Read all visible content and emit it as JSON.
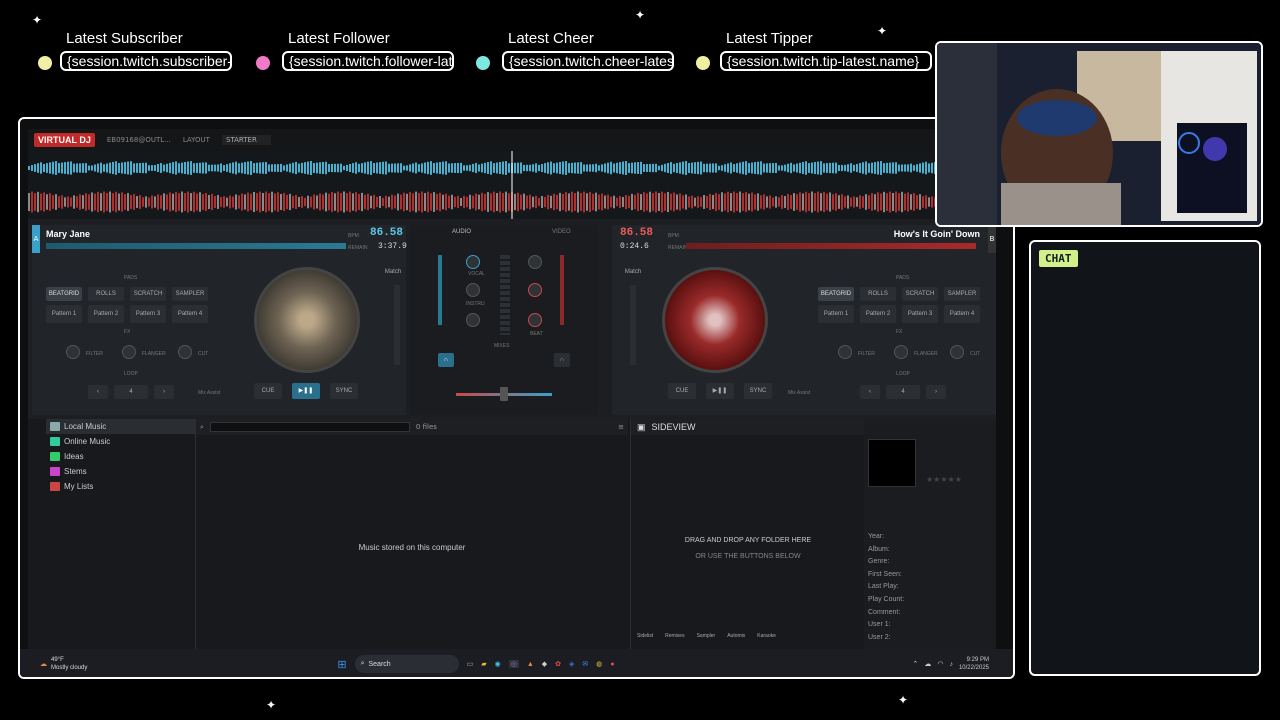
{
  "overlay": {
    "alerts": [
      {
        "title": "Latest Subscriber",
        "value": "{session.twitch.subscriber-latest.name}",
        "icon": "star-icon",
        "color": "#f2f0a8"
      },
      {
        "title": "Latest Follower",
        "value": "{session.twitch.follower-latest.name}",
        "icon": "heart-icon",
        "color": "#f07ac8"
      },
      {
        "title": "Latest Cheer",
        "value": "{session.twitch.cheer-latest.name}",
        "icon": "gem-icon",
        "color": "#7fe8e0"
      },
      {
        "title": "Latest Tipper",
        "value": "{session.twitch.tip-latest.name}",
        "icon": "coin-icon",
        "color": "#eef0a0"
      }
    ],
    "chat_label": "CHAT"
  },
  "vdj": {
    "logo": "VIRTUAL DJ",
    "user": "EB09168@OUTL...",
    "layout_label": "LAYOUT",
    "layout_value": "STARTER",
    "deck_a": {
      "letter": "A",
      "title": "Mary Jane",
      "bpm": "86.58",
      "bpm_label": "BPM",
      "remain_label": "REMAIN",
      "remain": "3:37.9"
    },
    "deck_b": {
      "letter": "B",
      "title": "How's It Goin' Down",
      "bpm": "86.58",
      "bpm_label": "BPM",
      "remain_label": "REMAIN",
      "remain": "0:24.6"
    },
    "pads_label": "PADS",
    "pad_modes": [
      "BEATGRID",
      "ROLLS",
      "SCRATCH",
      "SAMPLER"
    ],
    "patterns": [
      "Pattern 1",
      "Pattern 2",
      "Pattern 3",
      "Pattern 4"
    ],
    "fx_label": "FX",
    "fx": [
      "FILTER",
      "FLANGER",
      "CUT"
    ],
    "loop_label": "LOOP",
    "loop_value": "4",
    "match": "Match",
    "transport": {
      "cue": "CUE",
      "play": "▶❚❚",
      "sync": "SYNC"
    },
    "mix_assist": "Mix Assist",
    "mixer": {
      "audio": "AUDIO",
      "video": "VIDEO",
      "vocal": "VOCAL",
      "instru": "INSTRU",
      "beat": "BEAT",
      "mixes": "MIXES"
    },
    "browser": {
      "tree": [
        {
          "label": "Local Music",
          "color": "#8aa"
        },
        {
          "label": "Online Music",
          "color": "#3c9"
        },
        {
          "label": "Ideas",
          "color": "#3c6"
        },
        {
          "label": "Stems",
          "color": "#c4c"
        },
        {
          "label": "My Lists",
          "color": "#c44"
        }
      ],
      "files_count": "0 files",
      "empty_text": "Music stored on this computer",
      "sideview_label": "SIDEVIEW",
      "drop_line1": "DRAG AND DROP ANY FOLDER HERE",
      "drop_line2": "OR USE THE BUTTONS BELOW",
      "side_tabs": [
        "Sidelist",
        "Remixes",
        "Sampler",
        "Automix",
        "Karaoke"
      ],
      "info_fields": [
        "Year:",
        "Album:",
        "Genre:",
        "First Seen:",
        "Last Play:",
        "Play Count:",
        "Comment:",
        "User 1:",
        "User 2:"
      ],
      "folders_tab": "folders",
      "playlists_tab": "playlists",
      "info_tab": "info"
    }
  },
  "taskbar": {
    "weather_temp": "49°F",
    "weather_desc": "Mostly cloudy",
    "search_placeholder": "Search",
    "time": "9:29 PM",
    "date": "10/22/2025"
  }
}
